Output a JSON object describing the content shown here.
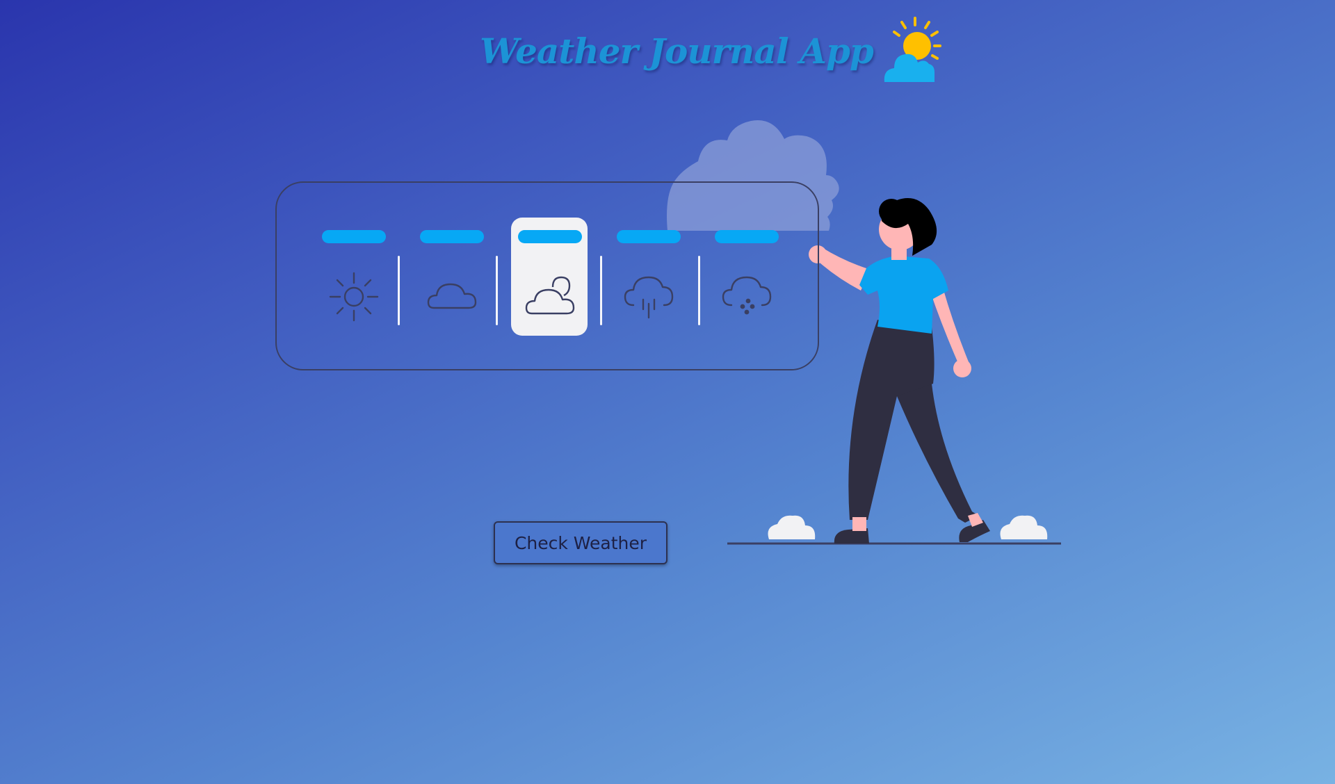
{
  "header": {
    "title": "Weather Journal App",
    "logo_icon": "sun-behind-cloud-icon"
  },
  "weather_selector": {
    "selected_index": 2,
    "options": [
      {
        "icon": "sun-icon"
      },
      {
        "icon": "cloud-icon"
      },
      {
        "icon": "partly-cloudy-icon"
      },
      {
        "icon": "rain-cloud-icon"
      },
      {
        "icon": "hail-cloud-icon"
      }
    ]
  },
  "actions": {
    "check_weather_label": "Check Weather"
  },
  "colors": {
    "accent": "#07a8f5",
    "title": "#1c93d6",
    "sun": "#ffc000",
    "shirt": "#0aa3f0",
    "pants": "#2f2e41",
    "skin": "#ffb6b6"
  }
}
